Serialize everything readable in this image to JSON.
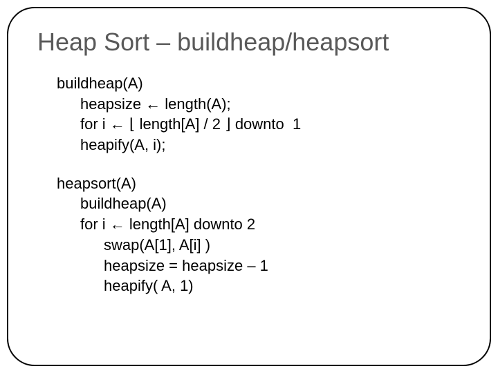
{
  "title": "Heap Sort – buildheap/heapsort",
  "block1": {
    "l0": "buildheap(A)",
    "l1": "heapsize ← length(A);",
    "l2": "for i ← ⌊ length[A] / 2 ⌋ downto  1",
    "l3": "heapify(A, i);"
  },
  "block2": {
    "l0": "heapsort(A)",
    "l1": "buildheap(A)",
    "l2": "for i ← length[A] downto 2",
    "l3": "swap(A[1], A[i] )",
    "l4": "heapsize = heapsize – 1",
    "l5": "heapify( A, 1)"
  }
}
